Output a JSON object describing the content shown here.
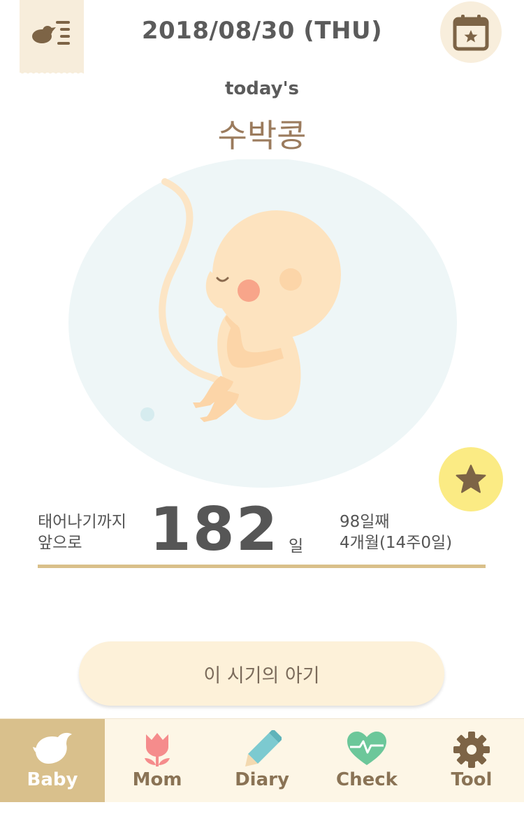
{
  "header": {
    "date": "2018/08/30 (THU)",
    "menu_icon": "baby-menu-icon",
    "calendar_icon": "calendar-star-icon"
  },
  "today": {
    "label": "today's",
    "baby_name": "수박콩"
  },
  "illustration": {
    "name": "fetus-illustration"
  },
  "dday": {
    "prefix_line1": "태어나기까지",
    "prefix_line2": "앞으로",
    "count": "182",
    "unit": "일",
    "info_line1": "98일째",
    "info_line2": "4개월(14주0일)"
  },
  "favorite_icon": "star-icon",
  "period_button": {
    "label": "이 시기의 아기"
  },
  "tabs": [
    {
      "label": "Baby",
      "icon": "bird-icon",
      "active": true
    },
    {
      "label": "Mom",
      "icon": "tulip-icon",
      "active": false
    },
    {
      "label": "Diary",
      "icon": "pencil-icon",
      "active": false
    },
    {
      "label": "Check",
      "icon": "heart-pulse-icon",
      "active": false
    },
    {
      "label": "Tool",
      "icon": "gear-icon",
      "active": false
    }
  ],
  "colors": {
    "accent": "#d9c08c",
    "background_pale": "#fdf6e6",
    "star_yellow": "#fbeb84",
    "brown": "#8a7355"
  }
}
